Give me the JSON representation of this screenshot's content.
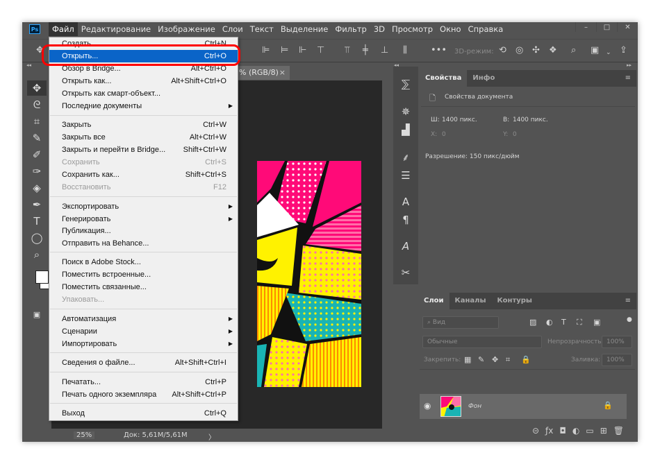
{
  "app": {
    "logo": "Ps"
  },
  "menubar": [
    "Файл",
    "Редактирование",
    "Изображение",
    "Слои",
    "Текст",
    "Выделение",
    "Фильтр",
    "3D",
    "Просмотр",
    "Окно",
    "Справка"
  ],
  "window_controls": [
    "–",
    "□",
    "✕"
  ],
  "optionsbar": {
    "mode_3d": "3D-режим:"
  },
  "document": {
    "tab_title": "% (RGB/8)",
    "tab_close": "×"
  },
  "status": {
    "zoom": "25%",
    "doc": "Док: 5,61M/5,61M",
    "arrow": "〉"
  },
  "file_menu": [
    {
      "label": "Создать...",
      "shortcut": "Ctrl+N"
    },
    {
      "label": "Открыть...",
      "shortcut": "Ctrl+O",
      "highlight": true
    },
    {
      "label": "Обзор в Bridge...",
      "shortcut": "Alt+Ctrl+O"
    },
    {
      "label": "Открыть как...",
      "shortcut": "Alt+Shift+Ctrl+O"
    },
    {
      "label": "Открыть как смарт-объект..."
    },
    {
      "label": "Последние документы",
      "submenu": true
    },
    {
      "label": "Закрыть",
      "shortcut": "Ctrl+W"
    },
    {
      "label": "Закрыть все",
      "shortcut": "Alt+Ctrl+W"
    },
    {
      "label": "Закрыть и перейти в Bridge...",
      "shortcut": "Shift+Ctrl+W"
    },
    {
      "label": "Сохранить",
      "shortcut": "Ctrl+S",
      "disabled": true
    },
    {
      "label": "Сохранить как...",
      "shortcut": "Shift+Ctrl+S"
    },
    {
      "label": "Восстановить",
      "shortcut": "F12",
      "disabled": true
    },
    {
      "label": "Экспортировать",
      "submenu": true
    },
    {
      "label": "Генерировать",
      "submenu": true
    },
    {
      "label": "Публикация..."
    },
    {
      "label": "Отправить на Behance..."
    },
    {
      "label": "Поиск в Adobe Stock..."
    },
    {
      "label": "Поместить встроенные..."
    },
    {
      "label": "Поместить связанные..."
    },
    {
      "label": "Упаковать...",
      "disabled": true
    },
    {
      "label": "Автоматизация",
      "submenu": true
    },
    {
      "label": "Сценарии",
      "submenu": true
    },
    {
      "label": "Импортировать",
      "submenu": true
    },
    {
      "label": "Сведения о файле...",
      "shortcut": "Alt+Shift+Ctrl+I"
    },
    {
      "label": "Печатать...",
      "shortcut": "Ctrl+P"
    },
    {
      "label": "Печать одного экземпляра",
      "shortcut": "Alt+Shift+Ctrl+P"
    },
    {
      "label": "Выход",
      "shortcut": "Ctrl+Q"
    }
  ],
  "properties_panel": {
    "tabs": [
      "Свойства",
      "Инфо"
    ],
    "doc_props": "Свойства документа",
    "w_label": "Ш:",
    "w_value": "1400 пикс.",
    "h_label": "В:",
    "h_value": "1400 пикс.",
    "x_label": "X:",
    "x_value": "0",
    "y_label": "Y:",
    "y_value": "0",
    "resolution": "Разрешение: 150 пикс/дюйм"
  },
  "layers_panel": {
    "tabs": [
      "Слои",
      "Каналы",
      "Контуры"
    ],
    "filter": "Вид",
    "blend": "Обычные",
    "opacity_label": "Непрозрачность:",
    "opacity_value": "100%",
    "lock_label": "Закрепить:",
    "fill_label": "Заливка:",
    "fill_value": "100%",
    "layer_name": "Фон"
  },
  "colors": {
    "highlight": "#0a64c8",
    "ring": "#ff0000",
    "pink": "#ff0a78",
    "yellow": "#fff200",
    "teal": "#19b4b4"
  }
}
